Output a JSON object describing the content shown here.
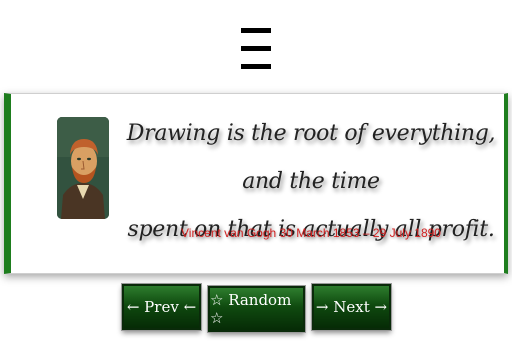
{
  "menu": {
    "icon": "hamburger-menu-icon"
  },
  "quote": {
    "line1": "Drawing is the root of everything, and the time",
    "line2": "spent on that is actually all profit.",
    "author": "Vincent van Gogh 30 March 1853 – 29 July 1890",
    "accent_color": "#1e7d1e",
    "author_color": "#d21f1f"
  },
  "nav": {
    "prev_label": "← Prev ←",
    "random_label": "☆ Random ☆",
    "next_label": "→ Next →"
  }
}
